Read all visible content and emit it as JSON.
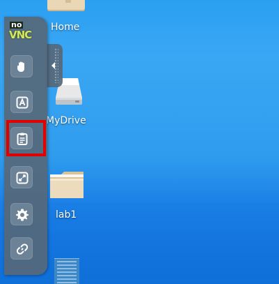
{
  "desktop": {
    "icons": [
      {
        "label": "Home"
      },
      {
        "label": "MyDrive"
      },
      {
        "label": "lab1"
      }
    ]
  },
  "novnc": {
    "logo": {
      "top": "no",
      "bottom": "VNC"
    },
    "buttons": [
      {
        "name": "drag-viewport",
        "icon": "hand-icon"
      },
      {
        "name": "extra-keys",
        "icon": "keyboard-key-icon"
      },
      {
        "name": "clipboard",
        "icon": "clipboard-icon",
        "highlighted": true
      },
      {
        "name": "fullscreen",
        "icon": "fullscreen-icon"
      },
      {
        "name": "settings",
        "icon": "gear-icon"
      },
      {
        "name": "disconnect",
        "icon": "disconnect-icon"
      }
    ],
    "colors": {
      "bar": "#56687a",
      "highlight": "#e10000",
      "logo": "#d5e75a"
    }
  }
}
